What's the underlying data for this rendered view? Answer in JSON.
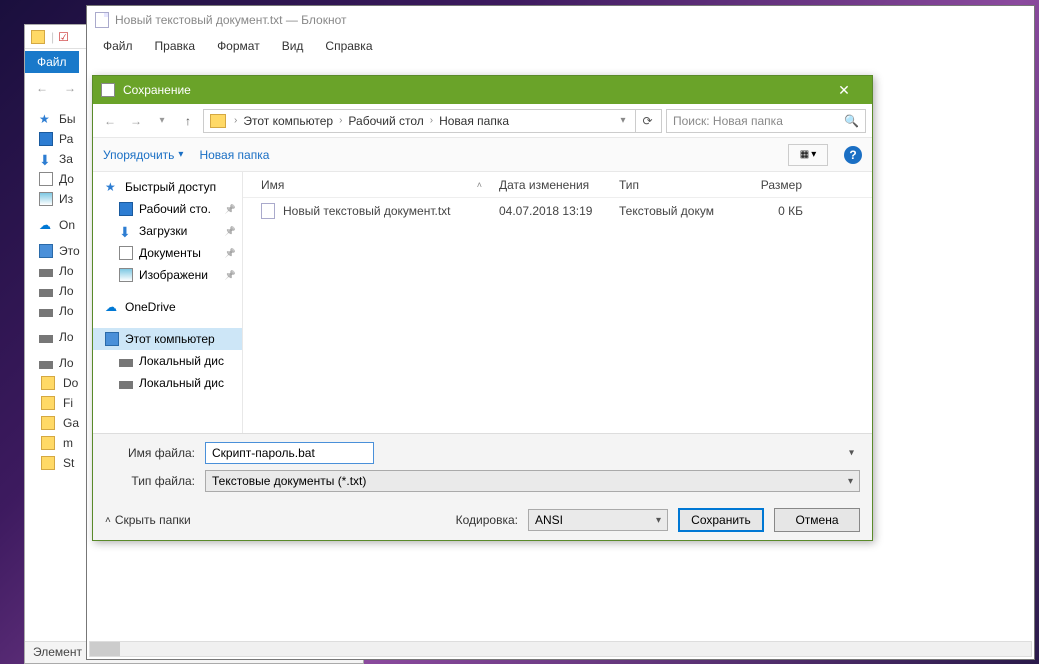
{
  "bg_explorer": {
    "file_tab": "Файл",
    "tree": [
      "Бы",
      "Ра",
      "За",
      "До",
      "Из",
      "",
      "On",
      "",
      "Это",
      "Ло",
      "Ло",
      "Ло",
      "",
      "Ло",
      "",
      "Ло",
      "Do",
      "Fi",
      "Ga",
      "m",
      "St"
    ],
    "status": "Элемент"
  },
  "notepad": {
    "title": "Новый текстовый документ.txt — Блокнот",
    "menu": [
      "Файл",
      "Правка",
      "Формат",
      "Вид",
      "Справка"
    ]
  },
  "dialog": {
    "title": "Сохранение",
    "breadcrumb": [
      "Этот компьютер",
      "Рабочий стол",
      "Новая папка"
    ],
    "search_placeholder": "Поиск: Новая папка",
    "toolbar": {
      "organize": "Упорядочить",
      "newfolder": "Новая папка"
    },
    "tree": {
      "quick": "Быстрый доступ",
      "desktop": "Рабочий сто.",
      "downloads": "Загрузки",
      "documents": "Документы",
      "pictures": "Изображени",
      "onedrive": "OneDrive",
      "thispc": "Этот компьютер",
      "disk1": "Локальный дис",
      "disk2": "Локальный дис"
    },
    "columns": {
      "name": "Имя",
      "date": "Дата изменения",
      "type": "Тип",
      "size": "Размер"
    },
    "files": [
      {
        "name": "Новый текстовый документ.txt",
        "date": "04.07.2018 13:19",
        "type": "Текстовый докум",
        "size": "0 КБ"
      }
    ],
    "fields": {
      "name_label": "Имя файла:",
      "name_value": "Скрипт-пароль.bat",
      "type_label": "Тип файла:",
      "type_value": "Текстовые документы (*.txt)"
    },
    "footer": {
      "hide_folders": "Скрыть папки",
      "encoding_label": "Кодировка:",
      "encoding_value": "ANSI",
      "save": "Сохранить",
      "cancel": "Отмена"
    }
  }
}
